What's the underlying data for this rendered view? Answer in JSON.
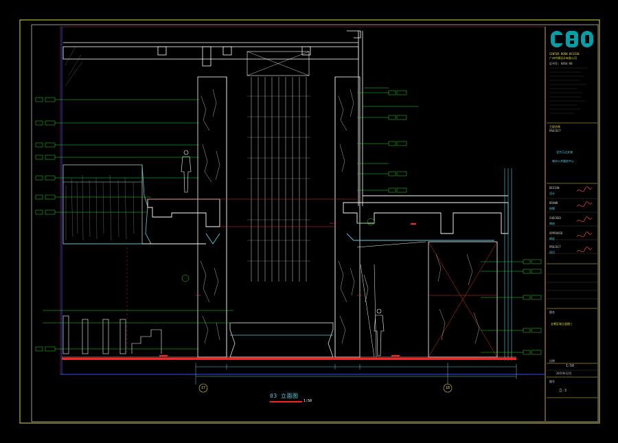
{
  "drawing": {
    "title": "03 立面图",
    "scale": "1:50",
    "axis_left": "17",
    "axis_right": "18"
  },
  "title_block": {
    "logo": "CBD",
    "company_en": "CENTER BORN DESIGN",
    "company_cn": "广州中建设计有限公司",
    "license": "证书号: 0464-88",
    "project_heading": "工程名称",
    "project_label": "PROJECT",
    "project_name_1": "北京万达文旅",
    "project_name_2": "城市公共服务中心",
    "roles": [
      {
        "cn": "设计",
        "en": "DESIGN"
      },
      {
        "cn": "绘图",
        "en": "DRAWN"
      },
      {
        "cn": "审核",
        "en": "CHECKED"
      },
      {
        "cn": "审定",
        "en": "APPROVED"
      },
      {
        "cn": "项目",
        "en": "PROJECT"
      }
    ],
    "drawing_name_label": "图名",
    "drawing_name": "全景区域立面图三",
    "scale_label": "比例",
    "scale_value": "1:50",
    "date_value": "2015年12月",
    "sheet_label": "图号",
    "sheet_value": "立-3"
  },
  "colors": {
    "frame": "#e8d84a",
    "border_inner": "#ffffff",
    "structure": "#ffffff",
    "dimension": "#5fd0e0",
    "leader": "#20e020",
    "marble": "#e0e0e0",
    "red_hatch": "#e03030",
    "floor_slab": "#ff2020",
    "axis_circle": "#e8d84a",
    "blue_line": "#3050ff"
  }
}
